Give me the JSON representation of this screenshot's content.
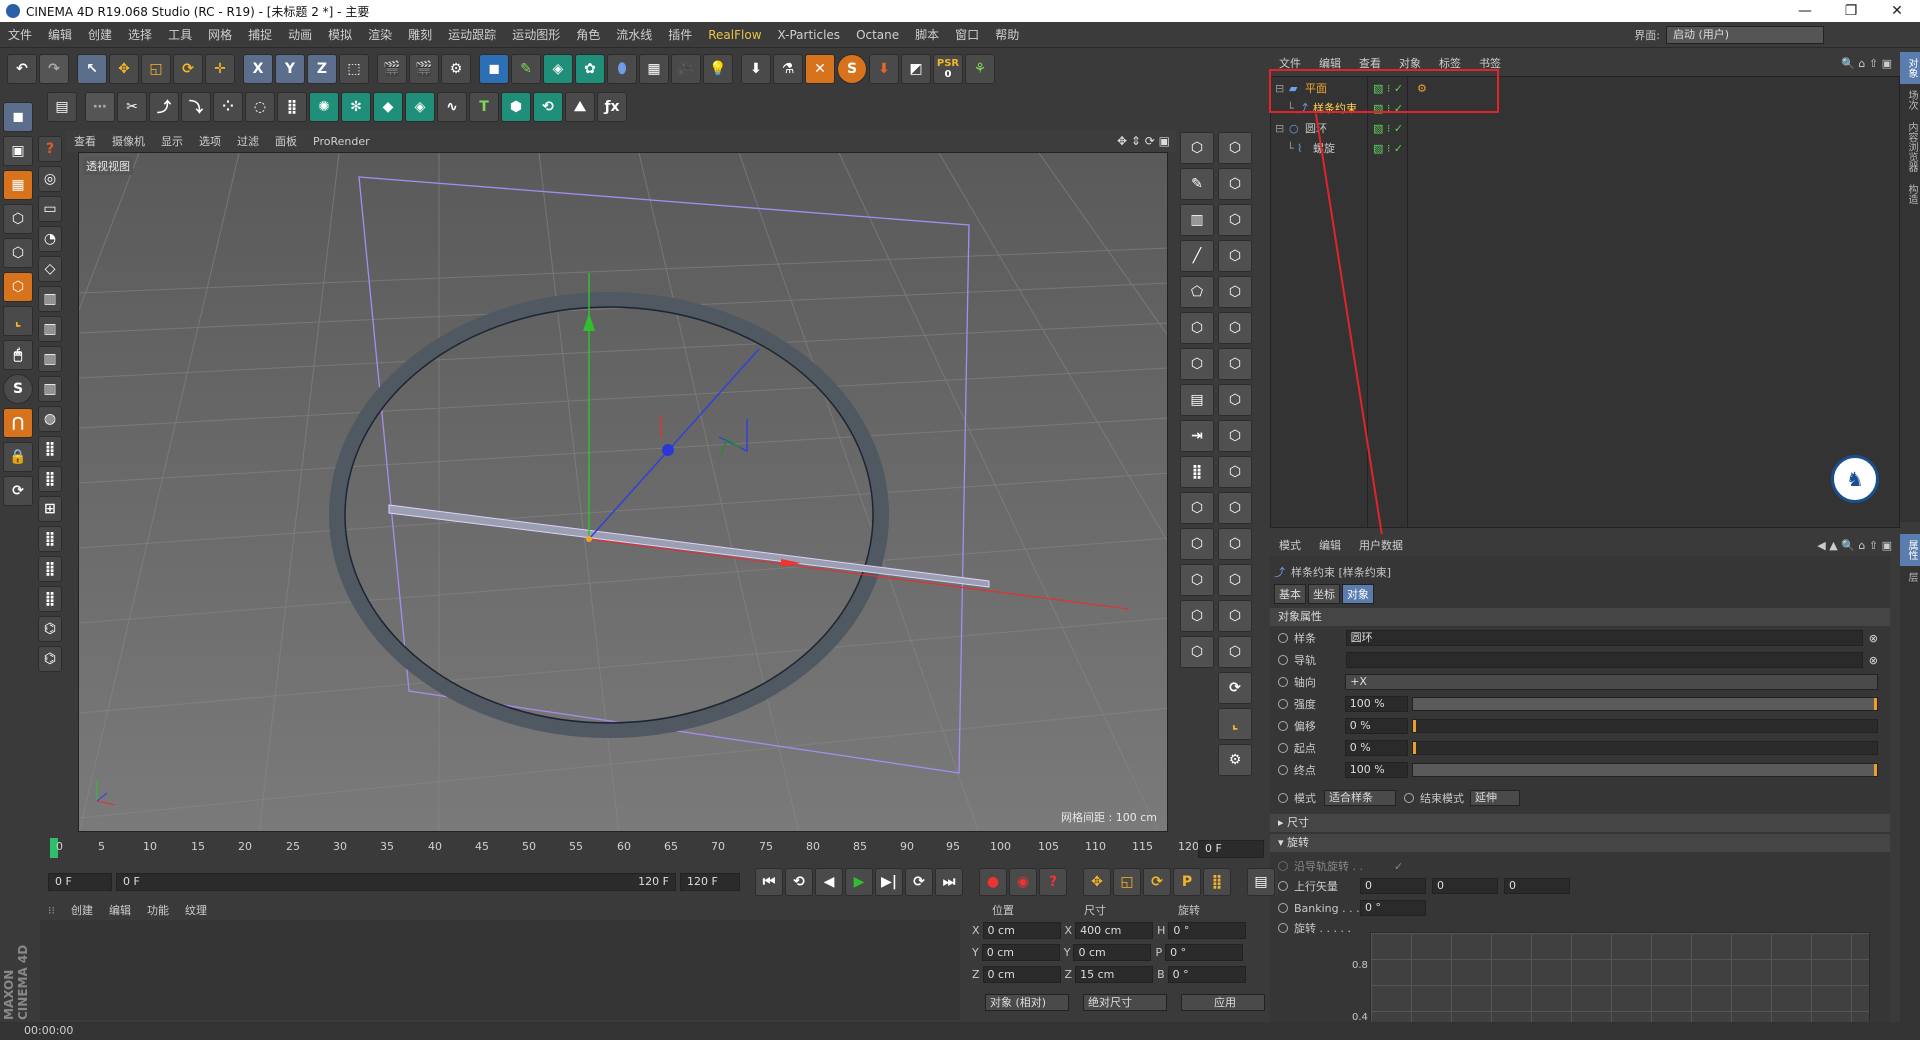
{
  "title": "CINEMA 4D R19.068 Studio (RC - R19) - [未标题 2 *] - 主要",
  "menu": [
    "文件",
    "编辑",
    "创建",
    "选择",
    "工具",
    "网格",
    "捕捉",
    "动画",
    "模拟",
    "渲染",
    "雕刻",
    "运动跟踪",
    "运动图形",
    "角色",
    "流水线",
    "插件",
    "RealFlow",
    "X-Particles",
    "Octane",
    "脚本",
    "窗口",
    "帮助"
  ],
  "interface_label": "界面:",
  "interface_value": "启动 (用户)",
  "viewport": {
    "menu": [
      "查看",
      "摄像机",
      "显示",
      "选项",
      "过滤",
      "面板",
      "ProRender"
    ],
    "name": "透视视图",
    "grid": "网格间距 : 100 cm"
  },
  "object_manager": {
    "menu": [
      "文件",
      "编辑",
      "查看",
      "对象",
      "标签",
      "书签"
    ],
    "objects": [
      {
        "name": "平面",
        "color": "#f0a52a"
      },
      {
        "name": "样条约束",
        "color": "#ffd44a"
      },
      {
        "name": "圆环",
        "color": "#c8c8c8"
      },
      {
        "name": "螺旋",
        "color": "#c8c8c8"
      }
    ]
  },
  "attribute_manager": {
    "menu": [
      "模式",
      "编辑",
      "用户数据"
    ],
    "header": "样条约束 [样条约束]",
    "tabs": [
      "基本",
      "坐标",
      "对象"
    ],
    "section": "对象属性",
    "spline_label": "样条",
    "spline_value": "圆环",
    "rail_label": "导轨",
    "axis_label": "轴向",
    "axis_value": "+X",
    "strength_label": "强度",
    "strength_value": "100 %",
    "offset_label": "偏移",
    "offset_value": "0 %",
    "start_label": "起点",
    "start_value": "0 %",
    "end_label": "终点",
    "end_value": "100 %",
    "mode_label": "模式",
    "mode_value": "适合样条",
    "endmode_label": "结束模式",
    "endmode_value": "延伸",
    "size_section": "尺寸",
    "rotation_section": "旋转",
    "rail_rotation": "沿导轨旋转 . .",
    "up_vector_label": "上行矢量",
    "up_vector": [
      "0",
      "0",
      "0"
    ],
    "banking_label": "Banking . . .",
    "banking_value": "0 °",
    "rotation_label": "旋转 . . . . .",
    "graph_ticks": [
      "0.8",
      "0.4"
    ]
  },
  "timeline": {
    "ticks": [
      "0",
      "5",
      "10",
      "15",
      "20",
      "25",
      "30",
      "35",
      "40",
      "45",
      "50",
      "55",
      "60",
      "65",
      "70",
      "75",
      "80",
      "85",
      "90",
      "95",
      "100",
      "105",
      "110",
      "115",
      "120"
    ],
    "current_frame": "0 F",
    "start": "0 F",
    "start2": "0 F",
    "end": "120 F",
    "end2": "120 F"
  },
  "material_menu": [
    "创建",
    "编辑",
    "功能",
    "纹理"
  ],
  "coords": {
    "headers": [
      "位置",
      "尺寸",
      "旋转"
    ],
    "rows": [
      {
        "a": "X",
        "pos": "0 cm",
        "b": "X",
        "size": "400 cm",
        "c": "H",
        "rot": "0 °"
      },
      {
        "a": "Y",
        "pos": "0 cm",
        "b": "Y",
        "size": "0 cm",
        "c": "P",
        "rot": "0 °"
      },
      {
        "a": "Z",
        "pos": "0 cm",
        "b": "Z",
        "size": "15 cm",
        "c": "B",
        "rot": "0 °"
      }
    ],
    "mode1": "对象 (相对)",
    "mode2": "绝对尺寸",
    "apply": "应用"
  },
  "status": "00:00:00",
  "brand": "MAXON CINEMA 4D",
  "side_tabs_top": [
    "对象",
    "场次",
    "内容浏览器",
    "构造"
  ],
  "side_tabs_bottom": [
    "属性",
    "层"
  ],
  "psr": "PSR",
  "psr_value": "0"
}
